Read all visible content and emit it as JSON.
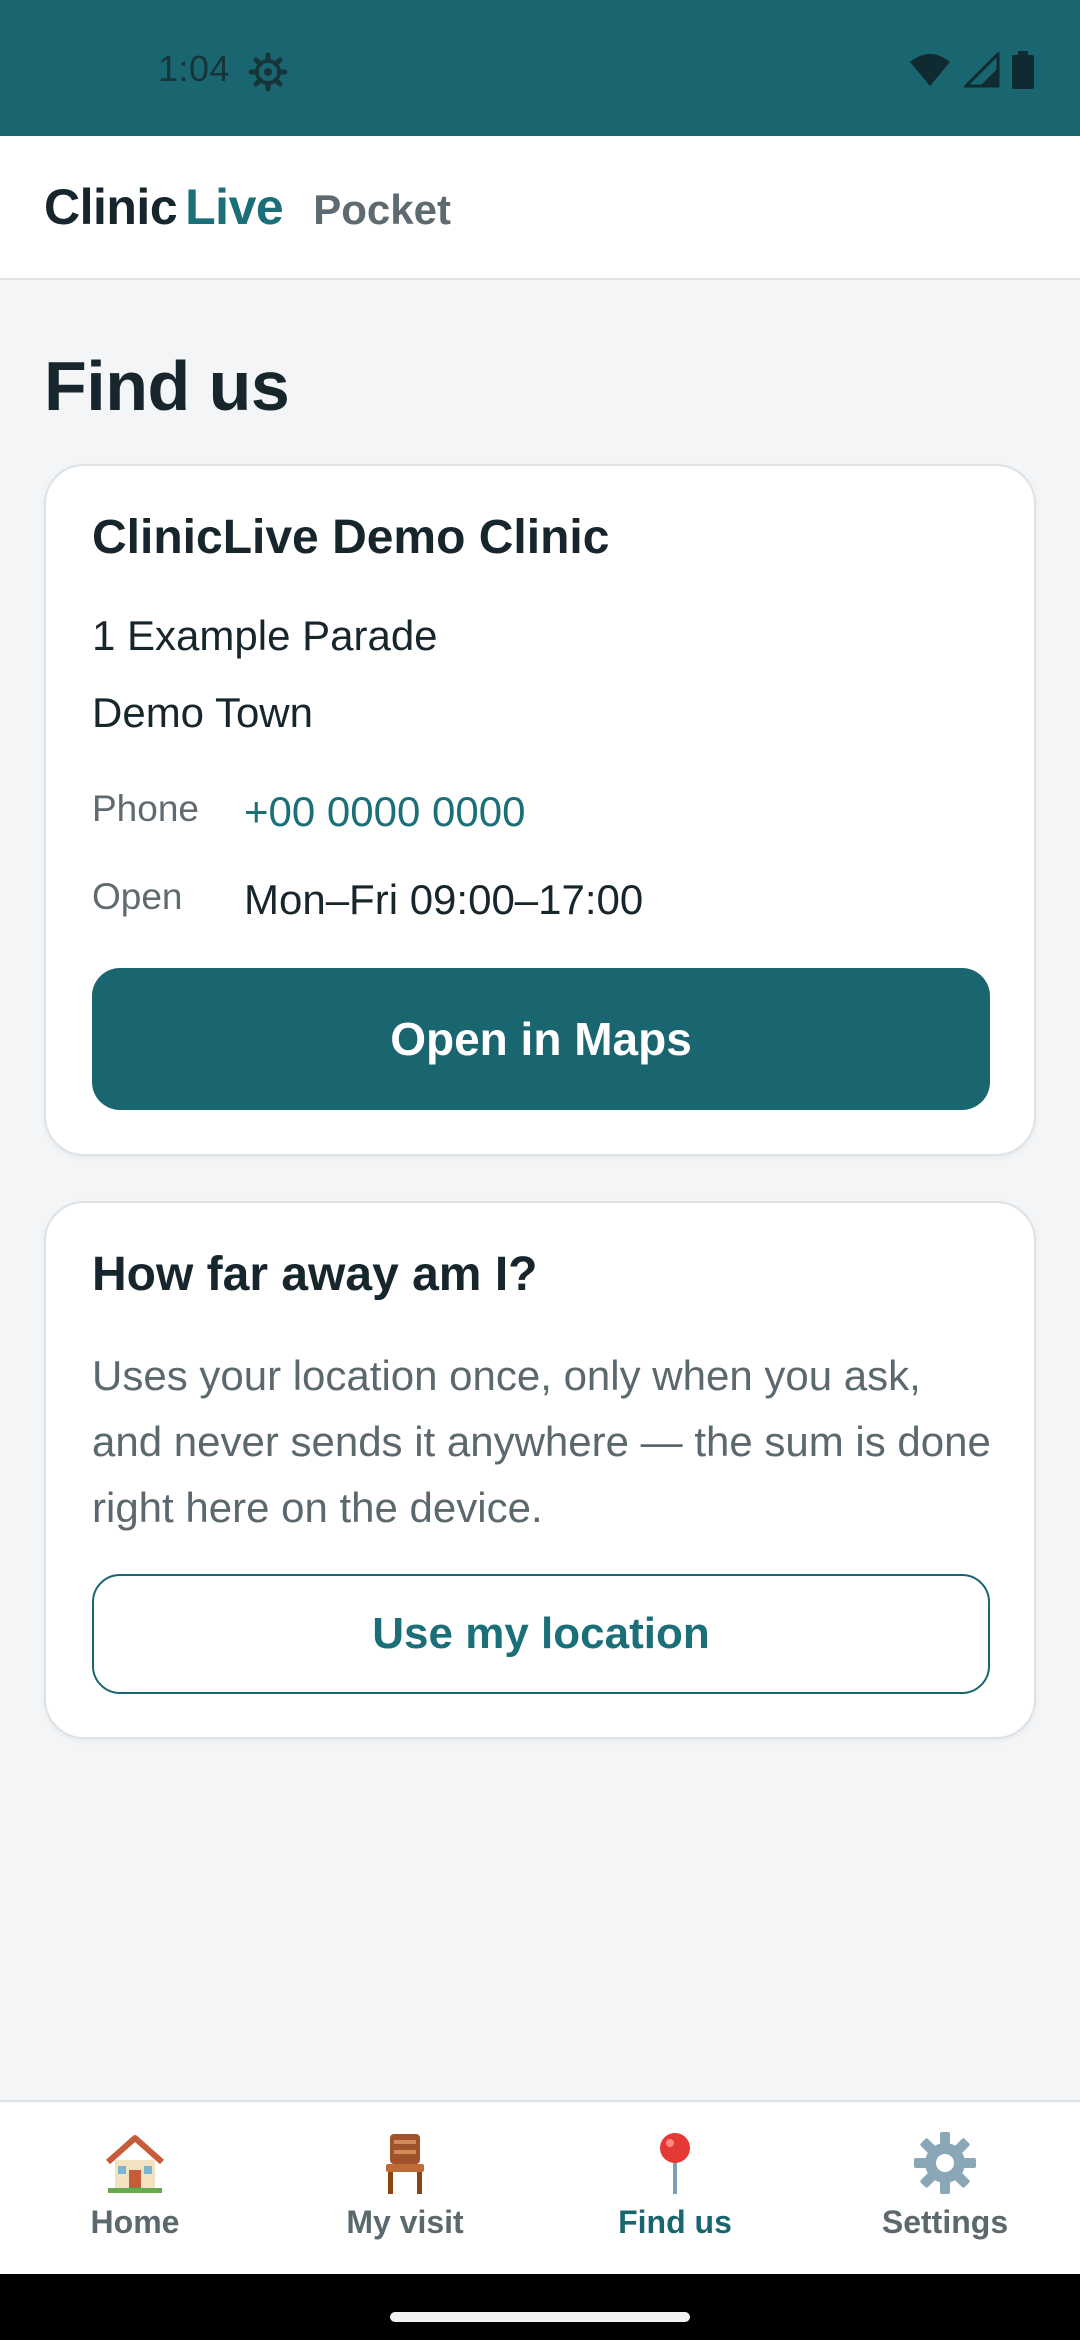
{
  "status_bar": {
    "time": "1:04",
    "icons": [
      "settings-gear-icon",
      "wifi-icon",
      "signal-icon",
      "battery-icon"
    ]
  },
  "header": {
    "brand_part1": "Clinic",
    "brand_part2": "Live",
    "subtitle": "Pocket"
  },
  "page": {
    "title": "Find us"
  },
  "clinic_card": {
    "name": "ClinicLive Demo Clinic",
    "address_line1": "1 Example Parade",
    "address_line2": "Demo Town",
    "phone_label": "Phone",
    "phone_value": "+00 0000 0000",
    "open_label": "Open",
    "open_value": "Mon–Fri 09:00–17:00",
    "maps_button": "Open in Maps"
  },
  "distance_card": {
    "title": "How far away am I?",
    "description": "Uses your location once, only when you ask, and never sends it anywhere — the sum is done right here on the device.",
    "location_button": "Use my location"
  },
  "bottom_nav": {
    "items": [
      {
        "label": "Home",
        "icon": "house-icon",
        "active": false
      },
      {
        "label": "My visit",
        "icon": "chair-icon",
        "active": false
      },
      {
        "label": "Find us",
        "icon": "map-pin-icon",
        "active": true
      },
      {
        "label": "Settings",
        "icon": "gear-icon",
        "active": false
      }
    ]
  },
  "colors": {
    "brand_teal": "#1a6670",
    "link_teal": "#1a6f78",
    "text_dark": "#17262c",
    "text_muted": "#5b686e",
    "background": "#f3f5f7"
  }
}
